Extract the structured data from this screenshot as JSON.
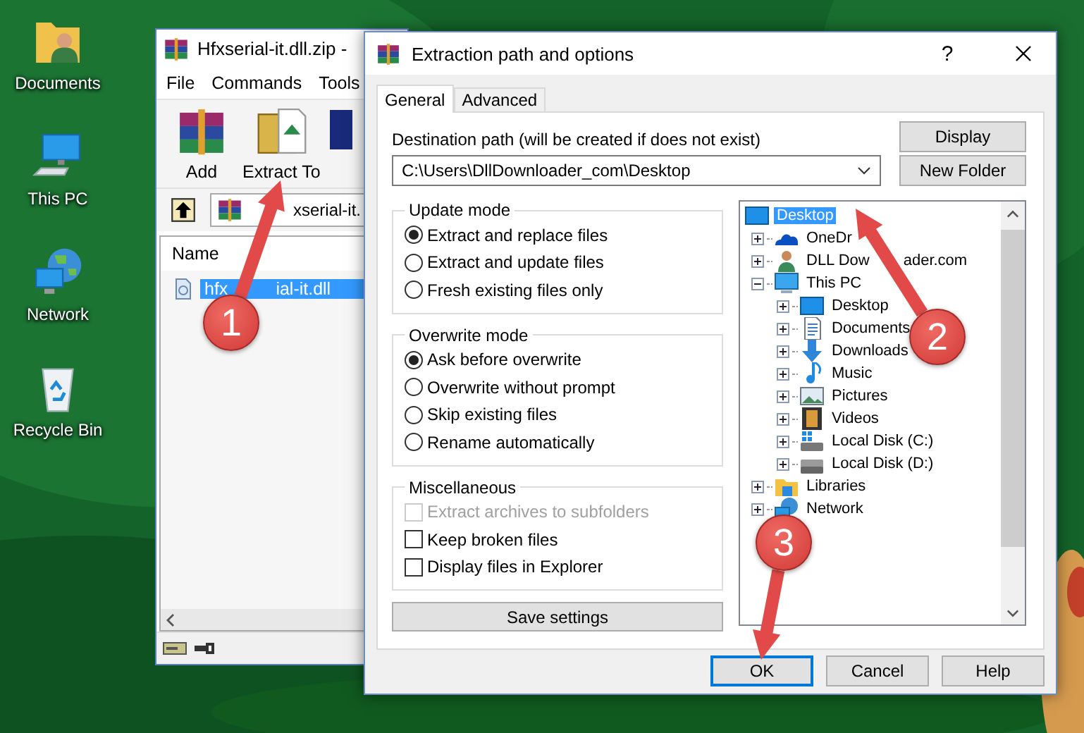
{
  "desktop_icons": [
    {
      "kind": "documents",
      "label": "Documents"
    },
    {
      "kind": "computer",
      "label": "This PC"
    },
    {
      "kind": "network",
      "label": "Network"
    },
    {
      "kind": "recycle-bin",
      "label": "Recycle Bin"
    }
  ],
  "archive_window": {
    "title": "Hfxserial-it.dll.zip -",
    "menu": [
      "File",
      "Commands",
      "Tools"
    ],
    "toolbar": [
      {
        "kind": "add",
        "label": "Add"
      },
      {
        "kind": "extract",
        "label": "Extract To"
      }
    ],
    "address": "xserial-it.",
    "columns": [
      "Name"
    ],
    "files": [
      {
        "name": "hfx",
        "name_tail": "ial-it.dll",
        "selected": true
      }
    ]
  },
  "dialog": {
    "title": "Extraction path and options",
    "help": "?",
    "tabs": [
      {
        "label": "General",
        "selected": true
      },
      {
        "label": "Advanced",
        "selected": false
      }
    ],
    "destination_label": "Destination path (will be created if does not exist)",
    "destination_path": "C:\\Users\\DllDownloader_com\\Desktop",
    "side_buttons": [
      "Display",
      "New Folder"
    ],
    "groups": [
      {
        "title": "Update mode",
        "kind": "radio",
        "options": [
          {
            "label": "Extract and replace files",
            "selected": true
          },
          {
            "label": "Extract and update files",
            "selected": false
          },
          {
            "label": "Fresh existing files only",
            "selected": false
          }
        ]
      },
      {
        "title": "Overwrite mode",
        "kind": "radio",
        "options": [
          {
            "label": "Ask before overwrite",
            "selected": true
          },
          {
            "label": "Overwrite without prompt",
            "selected": false
          },
          {
            "label": "Skip existing files",
            "selected": false
          },
          {
            "label": "Rename automatically",
            "selected": false
          }
        ]
      },
      {
        "title": "Miscellaneous",
        "kind": "checkbox",
        "options": [
          {
            "label": "Extract archives to subfolders",
            "checked": false,
            "disabled": true
          },
          {
            "label": "Keep broken files",
            "checked": false,
            "disabled": false
          },
          {
            "label": "Display files in Explorer",
            "checked": false,
            "disabled": false
          }
        ]
      }
    ],
    "save_button": "Save settings",
    "tree": [
      {
        "label": "Desktop",
        "kind": "desktop",
        "selected": true,
        "children": [
          {
            "label": "OneDr",
            "kind": "onedrive",
            "selected": false,
            "expanded": false
          },
          {
            "label": "DLL Dow",
            "label_tail": "ader.com",
            "kind": "user",
            "selected": false,
            "expanded": false
          },
          {
            "label": "This PC",
            "kind": "computer",
            "selected": false,
            "expanded": true,
            "children": [
              {
                "label": "Desktop",
                "kind": "desktop",
                "selected": false,
                "expanded": false
              },
              {
                "label": "Documents",
                "kind": "documents",
                "selected": false,
                "expanded": false
              },
              {
                "label": "Downloads",
                "kind": "downloads",
                "selected": false,
                "expanded": false
              },
              {
                "label": "Music",
                "kind": "music",
                "selected": false,
                "expanded": false
              },
              {
                "label": "Pictures",
                "kind": "pictures",
                "selected": false,
                "expanded": false
              },
              {
                "label": "Videos",
                "kind": "videos",
                "selected": false,
                "expanded": false
              },
              {
                "label": "Local Disk (C:)",
                "kind": "system-disk",
                "selected": false,
                "expanded": false
              },
              {
                "label": "Local Disk (D:)",
                "kind": "disk",
                "selected": false,
                "expanded": false
              }
            ]
          },
          {
            "label": "Libraries",
            "kind": "libraries",
            "selected": false,
            "expanded": false
          },
          {
            "label": "Network",
            "kind": "network",
            "selected": false,
            "expanded": false
          }
        ]
      }
    ],
    "buttons": [
      {
        "label": "OK",
        "default": true
      },
      {
        "label": "Cancel",
        "default": false
      },
      {
        "label": "Help",
        "default": false
      }
    ]
  },
  "annotations": [
    {
      "number": "1"
    },
    {
      "number": "2"
    },
    {
      "number": "3"
    }
  ]
}
